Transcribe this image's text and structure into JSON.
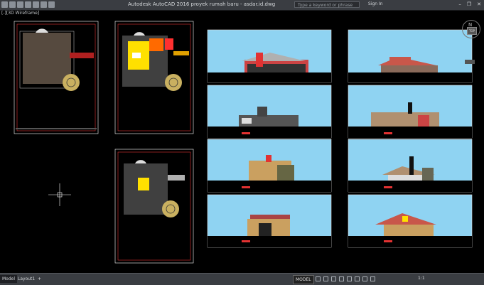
{
  "app": {
    "title": "Autodesk AutoCAD 2016    proyek rumah baru - asdar.id.dwg",
    "search_placeholder": "Type a keyword or phrase",
    "signin": "Sign In",
    "window_controls": [
      "–",
      "❐",
      "✕"
    ],
    "quick_access_icons": [
      "new-icon",
      "open-icon",
      "save-icon",
      "saveas-icon",
      "print-icon",
      "undo-icon",
      "redo-icon"
    ]
  },
  "viewport": {
    "label": "[-][3D Wireframe]",
    "nav_cube_letter": "N",
    "nav_cube_face": "TOP"
  },
  "status": {
    "tabs": [
      "Model",
      "Layout1",
      "+"
    ],
    "model_button": "MODEL",
    "scale": "1:1"
  },
  "colors": {
    "sky": "#8fd3f2",
    "frame_border": "#e0e0e0",
    "sheet_border": "#e23232",
    "floor_plan_fill": "#ffe000"
  }
}
